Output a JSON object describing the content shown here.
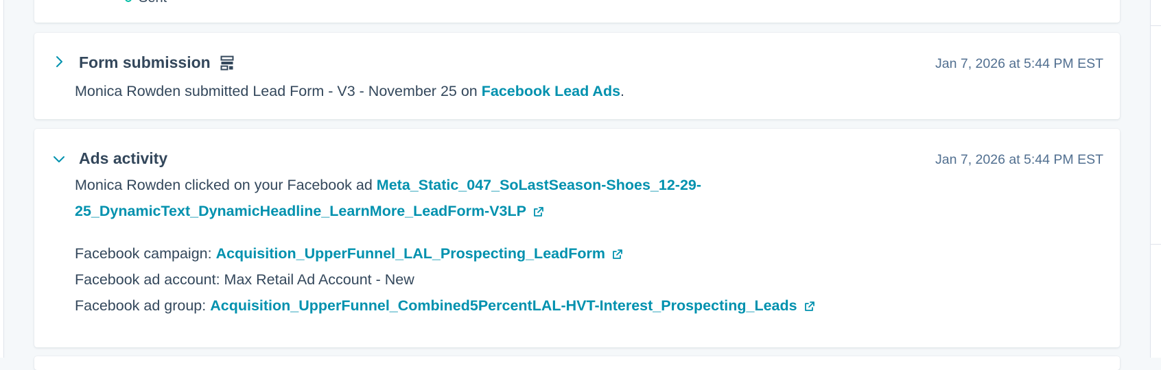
{
  "top_card": {
    "partial_text": "Sent"
  },
  "form_submission": {
    "title": "Form submission",
    "timestamp": "Jan 7, 2026 at 5:44 PM EST",
    "description_prefix": "Monica Rowden submitted Lead Form - V3 - November 25 on ",
    "source_link": "Facebook Lead Ads",
    "description_suffix": "."
  },
  "ads_activity": {
    "title": "Ads activity",
    "timestamp": "Jan 7, 2026 at 5:44 PM EST",
    "click_prefix": "Monica Rowden clicked on your Facebook ad ",
    "ad_name": "Meta_Static_047_SoLastSeason-Shoes_12-29-25_DynamicText_DynamicHeadline_LearnMore_LeadForm-V3LP",
    "campaign_label": "Facebook campaign: ",
    "campaign_value": "Acquisition_UpperFunnel_LAL_Prospecting_LeadForm",
    "account_label": "Facebook ad account: ",
    "account_value": "Max Retail Ad Account - New",
    "group_label": "Facebook ad group: ",
    "group_value": "Acquisition_UpperFunnel_Combined5PercentLAL-HVT-Interest_Prospecting_Leads"
  },
  "icons": {
    "expand_collapsed": "chevron-right-icon",
    "expand_open": "chevron-down-icon",
    "form": "form-icon",
    "external": "external-link-icon"
  },
  "colors": {
    "link": "#0091ae",
    "text": "#33475b",
    "muted": "#516f90",
    "background": "#f5f8fa",
    "status_dot": "#00bda5"
  }
}
